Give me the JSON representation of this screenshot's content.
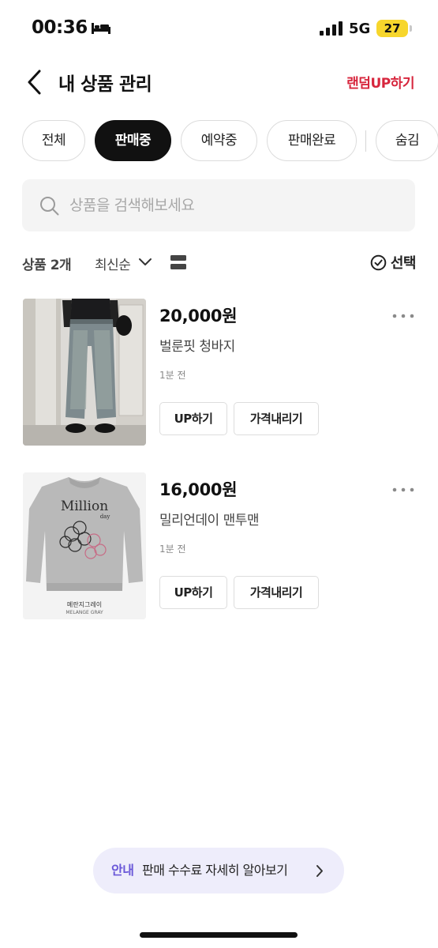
{
  "status_bar": {
    "time": "00:36",
    "network": "5G",
    "battery": "27"
  },
  "header": {
    "title": "내 상품 관리",
    "random_up": "랜덤UP하기"
  },
  "tabs": [
    {
      "label": "전체",
      "active": false
    },
    {
      "label": "판매중",
      "active": true
    },
    {
      "label": "예약중",
      "active": false
    },
    {
      "label": "판매완료",
      "active": false
    },
    {
      "label": "숨김",
      "active": false
    }
  ],
  "search": {
    "placeholder": "상품을 검색해보세요",
    "value": ""
  },
  "list_header": {
    "count": "상품 2개",
    "sort": "최신순",
    "select": "선택"
  },
  "products": [
    {
      "price": "20,000원",
      "name": "벌룬핏 청바지",
      "time": "1분 전",
      "up_label": "UP하기",
      "price_down_label": "가격내리기"
    },
    {
      "price": "16,000원",
      "name": "밀리언데이 맨투맨",
      "time": "1분 전",
      "up_label": "UP하기",
      "price_down_label": "가격내리기",
      "image_text": {
        "brand": "Million",
        "brand_sub": "day",
        "color_kr": "메란지그레이",
        "color_en": "MELANGE GRAY"
      }
    }
  ],
  "notice": {
    "tag": "안내",
    "text": "판매 수수료 자세히 알아보기"
  },
  "colors": {
    "accent_red": "#d7263d",
    "notice_purple": "#6a58d8",
    "notice_bg": "#eeedfb",
    "active_tab": "#111111"
  }
}
